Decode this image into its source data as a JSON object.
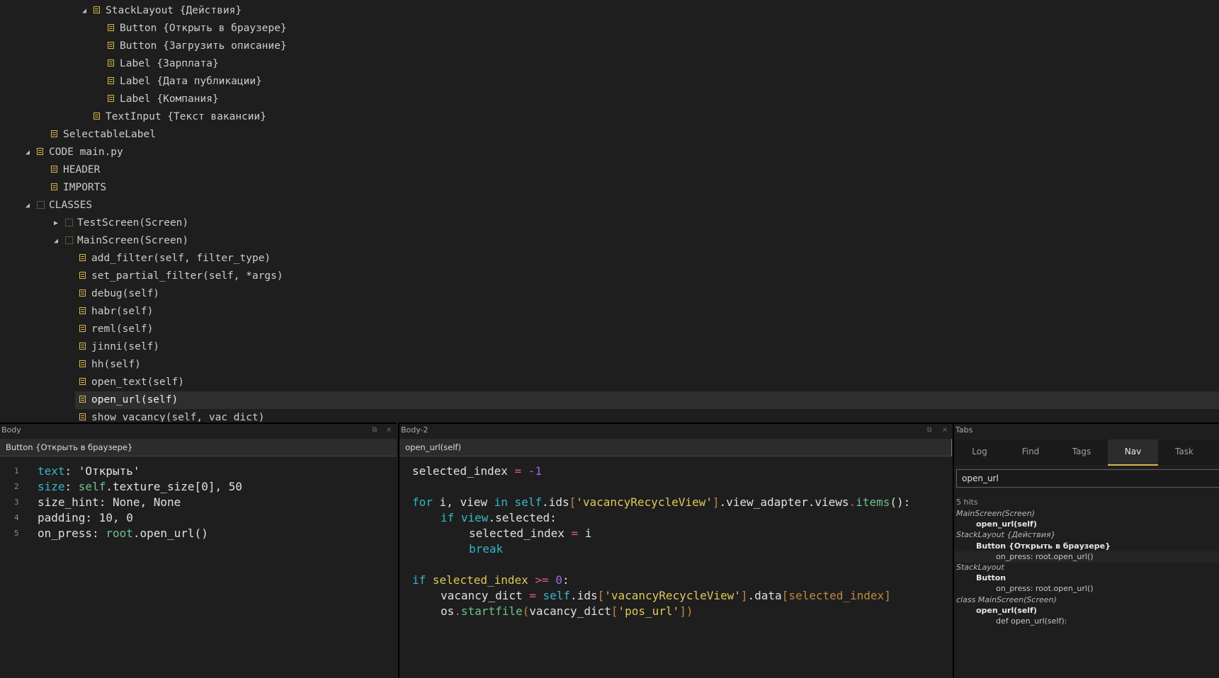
{
  "outline": [
    {
      "text": "StackLayout {Действия}",
      "twisty": "open"
    },
    {
      "text": "Button {Открыть в браузере}"
    },
    {
      "text": "Button {Загрузить описание}"
    },
    {
      "text": "Label {Зарплата}"
    },
    {
      "text": "Label {Дата публикации}"
    },
    {
      "text": "Label {Компания}"
    },
    {
      "text": "TextInput {Текст вакансии}"
    },
    {
      "text": "SelectableLabel"
    },
    {
      "text": "CODE main.py",
      "twisty": "open"
    },
    {
      "text": "HEADER"
    },
    {
      "text": "IMPORTS"
    },
    {
      "text": "CLASSES",
      "twisty": "open"
    },
    {
      "text": "TestScreen(Screen)",
      "twisty": "closed"
    },
    {
      "text": "MainScreen(Screen)",
      "twisty": "open"
    },
    {
      "text": "add_filter(self, filter_type)"
    },
    {
      "text": "set_partial_filter(self, *args)"
    },
    {
      "text": "debug(self)"
    },
    {
      "text": "habr(self)"
    },
    {
      "text": "reml(self)"
    },
    {
      "text": "jinni(self)"
    },
    {
      "text": "hh(self)"
    },
    {
      "text": "open_text(self)"
    },
    {
      "text": "open_url(self)",
      "selected": true
    },
    {
      "text": "show_vacancy(self, vac_dict)"
    }
  ],
  "body": {
    "title": "Body",
    "headline": "Button {Открыть в браузере}",
    "line_numbers": [
      "1",
      "2",
      "3",
      "4",
      "5"
    ],
    "t": {
      "l1a": "text",
      "l1b": ": ",
      "l1c": "'Открыть'",
      "l2a": "size",
      "l2b": ": ",
      "l2c": "self",
      "l2d": ".texture_size[0], 50",
      "l3": "size_hint: None, None",
      "l4": "padding: 10, 0",
      "l5a": "on_press",
      "l5b": ": ",
      "l5c": "root",
      "l5d": ".open_url()"
    }
  },
  "body2": {
    "title": "Body-2",
    "headline": "open_url(self)",
    "t": {
      "a1": "selected_index ",
      "a2": "=",
      "a3": " ",
      "a4": "-1",
      "b1": "for",
      "b2": " i, view ",
      "b3": "in",
      "b4": " ",
      "b5": "self",
      "b6": ".ids",
      "b7": "[",
      "b8": "'vacancyRecycleView'",
      "b9": "]",
      "b10": ".view_adapter",
      "b11": ".views",
      "b12": ".",
      "b13": "items",
      "b14": "():",
      "c1": "if",
      "c2": " ",
      "c3": "view",
      "c4": ".selected:",
      "d1": "selected_index ",
      "d2": "=",
      "d3": " i",
      "e1": "break",
      "f1": "if",
      "f2": " selected_index ",
      "f3": ">=",
      "f4": " ",
      "f5": "0",
      "f6": ":",
      "g1": "vacancy_dict ",
      "g2": "=",
      "g3": " ",
      "g4": "self",
      "g5": ".ids",
      "g6": "[",
      "g7": "'vacancyRecycleView'",
      "g8": "]",
      "g9": ".data",
      "g10": "[",
      "g11": "selected_index",
      "g12": "]",
      "h1": "os",
      "h2": ".",
      "h3": "startfile",
      "h4": "(",
      "h5": "vacancy_dict",
      "h6": "[",
      "h7": "'pos_url'",
      "h8": "])"
    }
  },
  "tabs_pane": {
    "title": "Tabs",
    "tabs": [
      "Log",
      "Find",
      "Tags",
      "Nav",
      "Task"
    ],
    "active_tab": "Nav",
    "search_value": "open_url",
    "hits_count": "5 hits",
    "results": [
      {
        "text": "MainScreen(Screen)",
        "style": "hdr",
        "indent": 0
      },
      {
        "text": "open_url(self)",
        "style": "bold",
        "indent": 1
      },
      {
        "text": "StackLayout {Действия}",
        "style": "hdr",
        "indent": 0
      },
      {
        "text": "Button {Открыть в браузере}",
        "style": "bold",
        "indent": 1
      },
      {
        "text": "on_press: root.open_url()",
        "style": "plain",
        "indent": 2,
        "highlight": true
      },
      {
        "text": "StackLayout",
        "style": "hdr",
        "indent": 0
      },
      {
        "text": "Button",
        "style": "bold",
        "indent": 1
      },
      {
        "text": "on_press: root.open_url()",
        "style": "plain",
        "indent": 2
      },
      {
        "text": "class MainScreen(Screen)",
        "style": "hdr",
        "indent": 0
      },
      {
        "text": "open_url(self)",
        "style": "bold",
        "indent": 1
      },
      {
        "text": "def open_url(self):",
        "style": "plain",
        "indent": 2
      }
    ]
  },
  "colors": {
    "background": "#1e1e1e",
    "accent": "#d9b84a",
    "keyword": "#32b5c8",
    "string": "#e0c85a",
    "number": "#9a6fd8",
    "operator": "#e0568c"
  }
}
